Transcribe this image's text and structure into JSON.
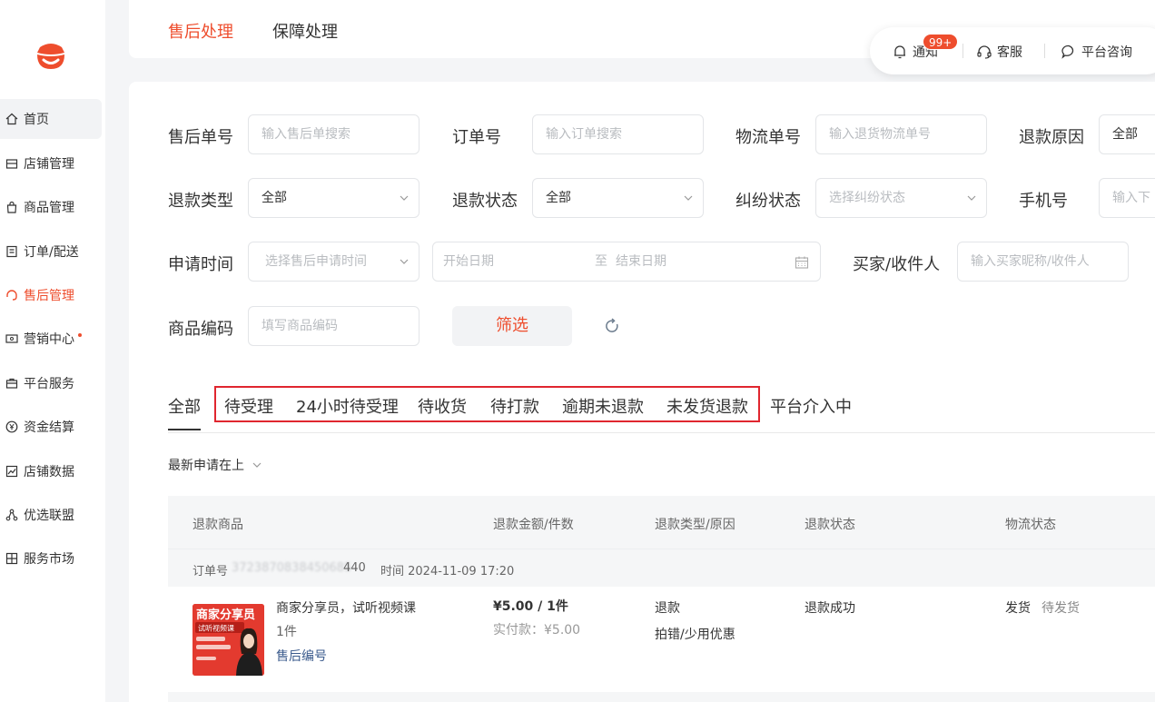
{
  "sidebar": {
    "items": [
      {
        "label": "首页",
        "icon": "home-icon"
      },
      {
        "label": "店铺管理",
        "icon": "store-icon"
      },
      {
        "label": "商品管理",
        "icon": "bag-icon"
      },
      {
        "label": "订单/配送",
        "icon": "order-icon"
      },
      {
        "label": "售后管理",
        "icon": "headset-icon"
      },
      {
        "label": "营销中心",
        "icon": "coupon-icon"
      },
      {
        "label": "平台服务",
        "icon": "briefcase-icon"
      },
      {
        "label": "资金结算",
        "icon": "yen-icon"
      },
      {
        "label": "店铺数据",
        "icon": "chart-icon"
      },
      {
        "label": "优选联盟",
        "icon": "network-icon"
      },
      {
        "label": "服务市场",
        "icon": "grid-icon"
      }
    ],
    "accent": "#ee4d2d"
  },
  "header": {
    "tabs": [
      "售后处理",
      "保障处理"
    ],
    "tools": {
      "notify": "通知",
      "badge": "99+",
      "service": "客服",
      "consult": "平台咨询"
    }
  },
  "filters": {
    "after_sale_no": {
      "label": "售后单号",
      "placeholder": "输入售后单搜索"
    },
    "order_no": {
      "label": "订单号",
      "placeholder": "输入订单搜索"
    },
    "logistics_no": {
      "label": "物流单号",
      "placeholder": "输入退货物流单号"
    },
    "refund_reason": {
      "label": "退款原因",
      "value": "全部"
    },
    "refund_type": {
      "label": "退款类型",
      "value": "全部"
    },
    "refund_status": {
      "label": "退款状态",
      "value": "全部"
    },
    "dispute_status": {
      "label": "纠纷状态",
      "placeholder": "选择纠纷状态"
    },
    "phone": {
      "label": "手机号",
      "placeholder": "输入下"
    },
    "apply_time": {
      "label": "申请时间",
      "placeholder": "选择售后申请时间",
      "start": "开始日期",
      "to": "至",
      "end": "结束日期"
    },
    "buyer": {
      "label": "买家/收件人",
      "placeholder": "输入买家昵称/收件人"
    },
    "product_code": {
      "label": "商品编码",
      "placeholder": "填写商品编码"
    },
    "filter_button": "筛选"
  },
  "status_tabs": [
    "全部",
    "待受理",
    "24小时待受理",
    "待收货",
    "待打款",
    "逾期未退款",
    "未发货退款",
    "平台介入中"
  ],
  "sort": {
    "label": "最新申请在上"
  },
  "table": {
    "headers": [
      "退款商品",
      "退款金额/件数",
      "退款类型/原因",
      "退款状态",
      "物流状态"
    ],
    "order": {
      "label": "订单号",
      "number_hidden": "3723870838450685",
      "number_tail": "440",
      "time": "时间 2024-11-09 17:20"
    },
    "item": {
      "thumb_title": "商家分享员",
      "thumb_sub": "试听视频课",
      "name": "商家分享员，试听视频课",
      "qty": "1件",
      "after_sale_code": "售后编号",
      "amount": "¥5.00 / 1件",
      "paid": "实付款：¥5.00",
      "refund_type": "退款",
      "refund_reason": "拍错/少用优惠",
      "refund_status": "退款成功",
      "logistics": "发货",
      "logistics_status": "待发货"
    }
  }
}
